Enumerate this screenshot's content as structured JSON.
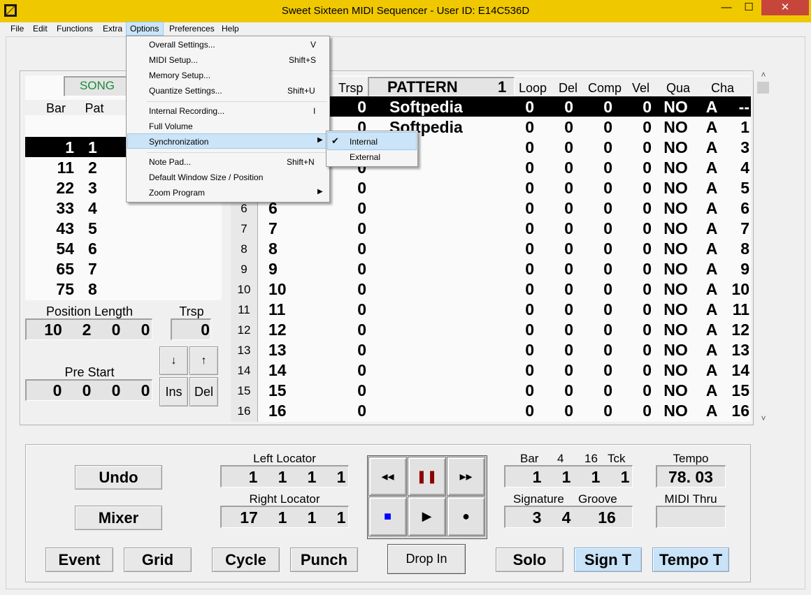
{
  "window": {
    "title": "Sweet Sixteen MIDI Sequencer - User ID: E14C536D",
    "min": "—",
    "max": "☐",
    "close": "✕"
  },
  "menubar": [
    "File",
    "Edit",
    "Functions",
    "Extra",
    "Options",
    "Preferences",
    "Help"
  ],
  "options_menu": {
    "items": [
      {
        "label": "Overall Settings...",
        "shortcut": "V"
      },
      {
        "label": "MIDI Setup...",
        "shortcut": "Shift+S"
      },
      {
        "label": "Memory Setup...",
        "shortcut": ""
      },
      {
        "label": "Quantize Settings...",
        "shortcut": "Shift+U"
      },
      {
        "label": "Internal Recording...",
        "shortcut": "I"
      },
      {
        "label": "Full Volume",
        "shortcut": ""
      },
      {
        "label": "Synchronization",
        "shortcut": ""
      },
      {
        "label": "Note Pad...",
        "shortcut": "Shift+N"
      },
      {
        "label": "Default Window Size / Position",
        "shortcut": ""
      },
      {
        "label": "Zoom Program",
        "shortcut": ""
      }
    ],
    "sync_submenu": {
      "items": [
        "Internal",
        "External"
      ],
      "checked": "Internal"
    }
  },
  "song": {
    "header": "SONG",
    "col_bar": "Bar",
    "col_pat": "Pat",
    "rows": [
      {
        "bar": "1",
        "pat": "1"
      },
      {
        "bar": "11",
        "pat": "2"
      },
      {
        "bar": "22",
        "pat": "3"
      },
      {
        "bar": "33",
        "pat": "4"
      },
      {
        "bar": "43",
        "pat": "5"
      },
      {
        "bar": "54",
        "pat": "6"
      },
      {
        "bar": "65",
        "pat": "7"
      },
      {
        "bar": "75",
        "pat": "8"
      }
    ],
    "position_length_label": "Position Length",
    "position_length": [
      "10",
      "2",
      "0",
      "0"
    ],
    "trsp_label": "Trsp",
    "trsp": "0",
    "pre_start_label": "Pre Start",
    "pre_start": [
      "0",
      "0",
      "0",
      "0"
    ],
    "btn_down": "↓",
    "btn_up": "↑",
    "btn_ins": "Ins",
    "btn_del": "Del"
  },
  "pattern": {
    "headers": {
      "trsp": "Trsp",
      "pattern": "PATTERN",
      "pattern_num": "1",
      "loop": "Loop",
      "del": "Del",
      "comp": "Comp",
      "vel": "Vel",
      "qua": "Qua",
      "cha": "Cha"
    },
    "rows": [
      {
        "num": "",
        "track": "",
        "trsp": "0",
        "name": "Softpedia",
        "loop": "0",
        "del": "0",
        "comp": "0",
        "vel": "0",
        "qua": "NO",
        "a": "A",
        "cha": "--"
      },
      {
        "num": "",
        "track": "",
        "trsp": "0",
        "name": "Softpedia",
        "loop": "0",
        "del": "0",
        "comp": "0",
        "vel": "0",
        "qua": "NO",
        "a": "A",
        "cha": "1"
      },
      {
        "num": "",
        "track": "",
        "trsp": "0",
        "name": "",
        "loop": "0",
        "del": "0",
        "comp": "0",
        "vel": "0",
        "qua": "NO",
        "a": "A",
        "cha": "3"
      },
      {
        "num": "",
        "track": "",
        "trsp": "0",
        "name": "",
        "loop": "0",
        "del": "0",
        "comp": "0",
        "vel": "0",
        "qua": "NO",
        "a": "A",
        "cha": "4"
      },
      {
        "num": "",
        "track": "",
        "trsp": "0",
        "name": "",
        "loop": "0",
        "del": "0",
        "comp": "0",
        "vel": "0",
        "qua": "NO",
        "a": "A",
        "cha": "5"
      },
      {
        "num": "6",
        "track": "6",
        "trsp": "0",
        "name": "",
        "loop": "0",
        "del": "0",
        "comp": "0",
        "vel": "0",
        "qua": "NO",
        "a": "A",
        "cha": "6"
      },
      {
        "num": "7",
        "track": "7",
        "trsp": "0",
        "name": "",
        "loop": "0",
        "del": "0",
        "comp": "0",
        "vel": "0",
        "qua": "NO",
        "a": "A",
        "cha": "7"
      },
      {
        "num": "8",
        "track": "8",
        "trsp": "0",
        "name": "",
        "loop": "0",
        "del": "0",
        "comp": "0",
        "vel": "0",
        "qua": "NO",
        "a": "A",
        "cha": "8"
      },
      {
        "num": "9",
        "track": "9",
        "trsp": "0",
        "name": "",
        "loop": "0",
        "del": "0",
        "comp": "0",
        "vel": "0",
        "qua": "NO",
        "a": "A",
        "cha": "9"
      },
      {
        "num": "10",
        "track": "10",
        "trsp": "0",
        "name": "",
        "loop": "0",
        "del": "0",
        "comp": "0",
        "vel": "0",
        "qua": "NO",
        "a": "A",
        "cha": "10"
      },
      {
        "num": "11",
        "track": "11",
        "trsp": "0",
        "name": "",
        "loop": "0",
        "del": "0",
        "comp": "0",
        "vel": "0",
        "qua": "NO",
        "a": "A",
        "cha": "11"
      },
      {
        "num": "12",
        "track": "12",
        "trsp": "0",
        "name": "",
        "loop": "0",
        "del": "0",
        "comp": "0",
        "vel": "0",
        "qua": "NO",
        "a": "A",
        "cha": "12"
      },
      {
        "num": "13",
        "track": "13",
        "trsp": "0",
        "name": "",
        "loop": "0",
        "del": "0",
        "comp": "0",
        "vel": "0",
        "qua": "NO",
        "a": "A",
        "cha": "13"
      },
      {
        "num": "14",
        "track": "14",
        "trsp": "0",
        "name": "",
        "loop": "0",
        "del": "0",
        "comp": "0",
        "vel": "0",
        "qua": "NO",
        "a": "A",
        "cha": "14"
      },
      {
        "num": "15",
        "track": "15",
        "trsp": "0",
        "name": "",
        "loop": "0",
        "del": "0",
        "comp": "0",
        "vel": "0",
        "qua": "NO",
        "a": "A",
        "cha": "15"
      },
      {
        "num": "16",
        "track": "16",
        "trsp": "0",
        "name": "",
        "loop": "0",
        "del": "0",
        "comp": "0",
        "vel": "0",
        "qua": "NO",
        "a": "A",
        "cha": "16"
      }
    ]
  },
  "transport": {
    "undo": "Undo",
    "mixer": "Mixer",
    "event": "Event",
    "grid": "Grid",
    "cycle": "Cycle",
    "punch": "Punch",
    "drop_in": "Drop In",
    "solo": "Solo",
    "sign_t": "Sign T",
    "tempo_t": "Tempo T",
    "left_locator_label": "Left Locator",
    "left_locator": [
      "1",
      "1",
      "1",
      "1"
    ],
    "right_locator_label": "Right Locator",
    "right_locator": [
      "17",
      "1",
      "1",
      "1"
    ],
    "bar_header": [
      "Bar",
      "4",
      "16",
      "Tck"
    ],
    "bar_values": [
      "1",
      "1",
      "1",
      "1"
    ],
    "signature_label": "Signature",
    "groove_label": "Groove",
    "signature_values": [
      "3",
      "4"
    ],
    "groove_value": "16",
    "tempo_label": "Tempo",
    "tempo_value": "78. 03",
    "midi_thru_label": "MIDI Thru",
    "midi_thru_value": ""
  },
  "colors": {
    "titlebar": "#f0c800",
    "song_header": "#1a8a3a",
    "selected_row": "#000000",
    "stop_icon": "#0000ff",
    "pause_icon": "#8b0000",
    "highlight": "#cce4f7"
  }
}
